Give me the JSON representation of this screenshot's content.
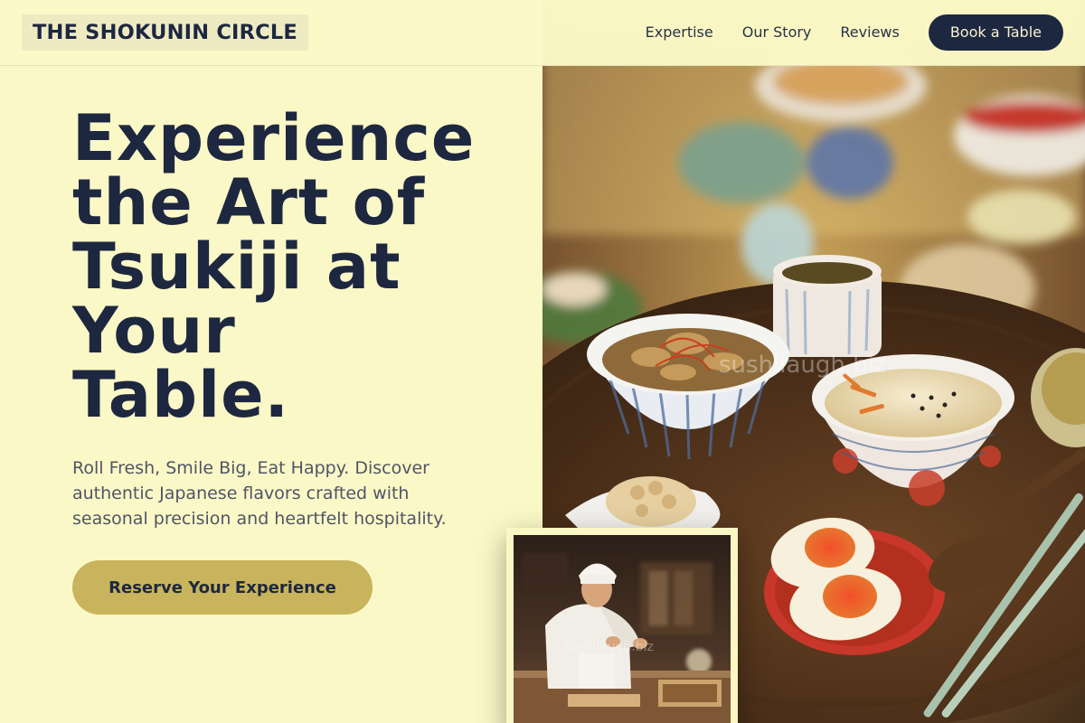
{
  "brand": {
    "name": "THE SHOKUNIN CIRCLE"
  },
  "nav": {
    "items": [
      {
        "label": "Expertise"
      },
      {
        "label": "Our Story"
      },
      {
        "label": "Reviews"
      }
    ],
    "cta": "Book a Table"
  },
  "hero": {
    "title_lines": [
      "Experience",
      "the Art of",
      "Tsukiji at",
      "Your",
      "Table."
    ],
    "subtitle": "Roll Fresh, Smile Big, Eat Happy. Discover authentic Japanese flavors crafted with seasonal precision and heartfelt hospitality.",
    "cta": "Reserve Your Experience"
  },
  "images": {
    "hero_food": {
      "watermark": "sushilaugh.biz"
    },
    "chef": {
      "watermark": "sushilaugh.biz"
    }
  },
  "colors": {
    "background": "#fbf8c7",
    "navy": "#1d2740",
    "gold": "#c8b45c",
    "text_muted": "#4f5566"
  },
  "icons": []
}
